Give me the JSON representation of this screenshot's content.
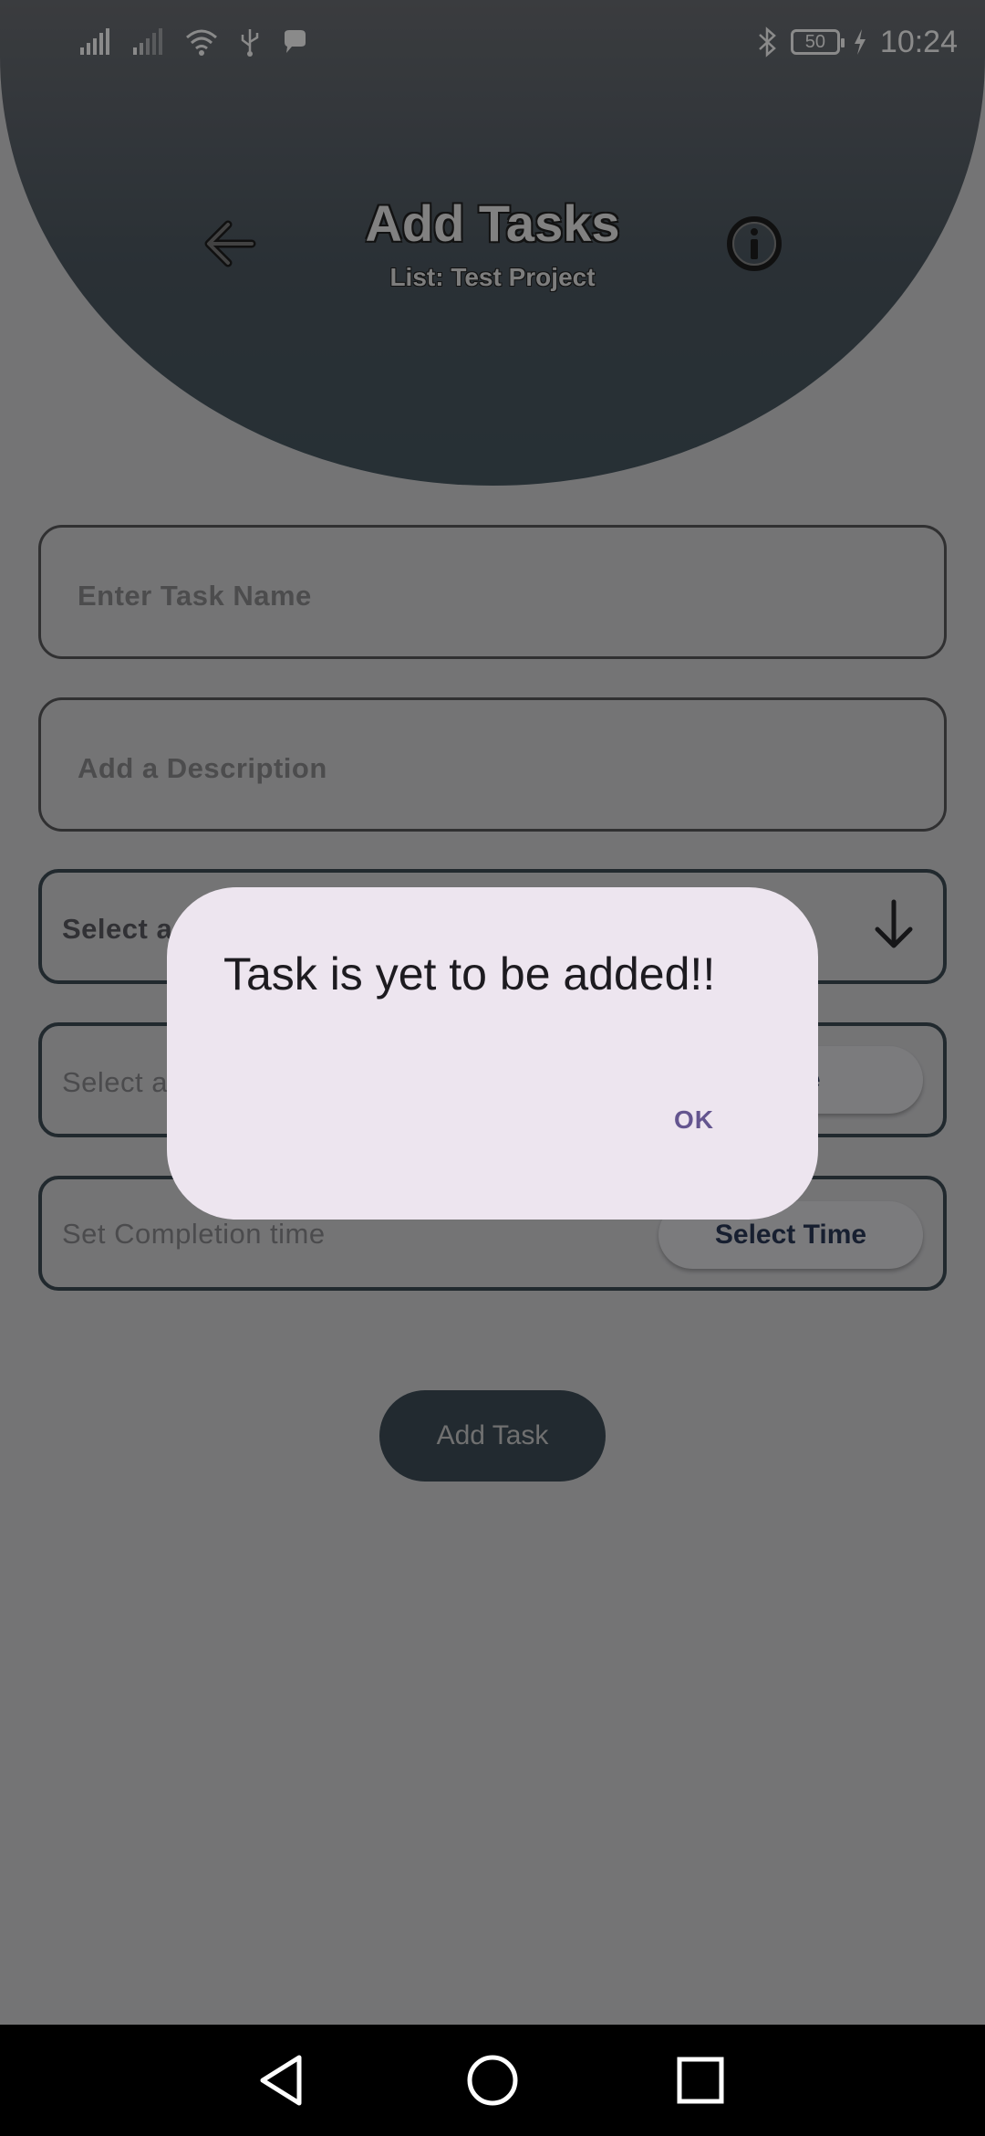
{
  "status_bar": {
    "battery": "50",
    "time": "10:24",
    "icons": [
      "signal-icon",
      "signal-icon",
      "wifi-icon",
      "usb-icon",
      "message-icon",
      "bluetooth-icon",
      "battery-icon",
      "charging-icon"
    ]
  },
  "header": {
    "title": "Add Tasks",
    "subtitle": "List: Test Project"
  },
  "form": {
    "task_name_placeholder": "Enter Task Name",
    "description_placeholder": "Add a Description",
    "priority_label": "Select a",
    "date_label": "Select a",
    "date_button": "Date",
    "time_label": "Set Completion time",
    "time_button": "Select Time",
    "submit_label": "Add Task"
  },
  "dialog": {
    "message": "Task is yet to be added!!",
    "ok_label": "OK"
  },
  "colors": {
    "header": "#485963",
    "dialog_bg": "#ede5ef",
    "accent": "#64558f",
    "button": "#3f4f59"
  }
}
